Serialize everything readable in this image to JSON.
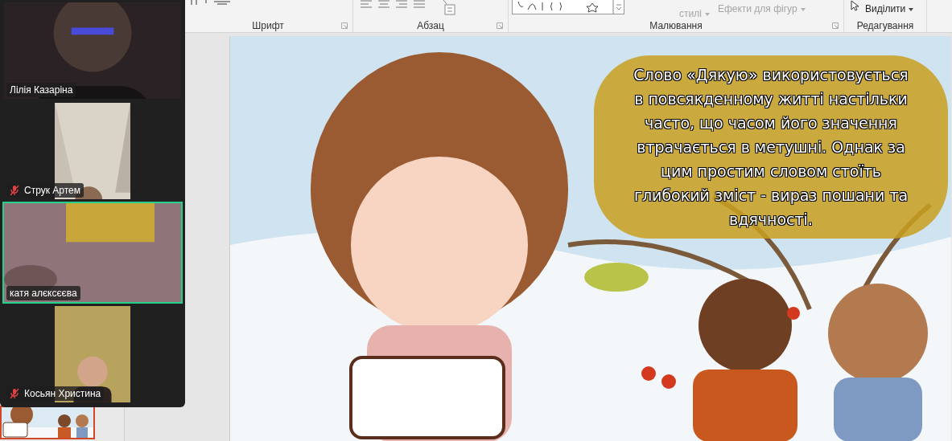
{
  "ribbon": {
    "groups": [
      {
        "label": "Шрифт",
        "launcher": true
      },
      {
        "label": "Абзац",
        "launcher": true
      },
      {
        "label": "Малювання",
        "launcher": true,
        "commands": [
          {
            "label": "стилі",
            "disabled": true
          },
          {
            "label": "Ефекти для фігур",
            "disabled": true
          }
        ]
      },
      {
        "label": "Редагування",
        "commands": [
          {
            "label": "Виділити",
            "disabled": false
          }
        ]
      }
    ]
  },
  "slides_pane": {
    "thumbnails": [
      {
        "kind": "picture",
        "selected": true
      }
    ]
  },
  "slide": {
    "kind": "picture",
    "speech_bubble": "Слово «Дякую» використовується в повсякденному житті настільки часто, що часом його значення втрачається в метушні. Однак за цим простим словом стоїть глибокий зміст - вираз пошани та вдячності."
  },
  "video_call": {
    "participants": [
      {
        "name": "Лілія Казаріна",
        "muted": false,
        "selected": false,
        "kind": "wide"
      },
      {
        "name": "Струк Артем",
        "muted": true,
        "selected": false,
        "kind": "portrait"
      },
      {
        "name": "катя алєксєєва",
        "muted": false,
        "selected": true,
        "kind": "wide"
      },
      {
        "name": "Косьян Христина",
        "muted": true,
        "selected": false,
        "kind": "portrait"
      }
    ]
  }
}
